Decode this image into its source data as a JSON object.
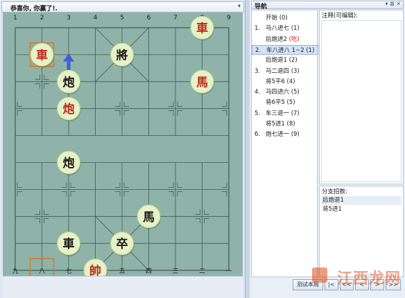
{
  "board_tab": {
    "title": "恭喜你, 你赢了!.",
    "arrow": "▾"
  },
  "board": {
    "top_files": [
      "1",
      "2",
      "3",
      "4",
      "5",
      "6",
      "7",
      "8",
      "9"
    ],
    "bottom_files": [
      "九",
      "八",
      "七",
      "六",
      "五",
      "四",
      "三",
      "二",
      "一"
    ],
    "pieces": [
      {
        "char": "車",
        "side": "red",
        "col": 7,
        "row": 0,
        "name": "red-chariot-piece"
      },
      {
        "char": "車",
        "side": "red",
        "col": 1,
        "row": 1,
        "name": "red-chariot-piece-2"
      },
      {
        "char": "將",
        "side": "black",
        "col": 4,
        "row": 1,
        "name": "black-general-piece"
      },
      {
        "char": "炮",
        "side": "black",
        "col": 2,
        "row": 2,
        "name": "black-cannon-piece"
      },
      {
        "char": "馬",
        "side": "red",
        "col": 7,
        "row": 2,
        "name": "red-horse-piece"
      },
      {
        "char": "炮",
        "side": "red",
        "col": 2,
        "row": 3,
        "name": "red-cannon-piece"
      },
      {
        "char": "炮",
        "side": "black",
        "col": 2,
        "row": 5,
        "name": "black-cannon-piece-2"
      },
      {
        "char": "馬",
        "side": "black",
        "col": 5,
        "row": 7,
        "name": "black-horse-piece"
      },
      {
        "char": "車",
        "side": "black",
        "col": 2,
        "row": 8,
        "name": "black-chariot-piece"
      },
      {
        "char": "卒",
        "side": "black",
        "col": 4,
        "row": 8,
        "name": "black-soldier-piece"
      },
      {
        "char": "帥",
        "side": "red",
        "col": 3,
        "row": 9,
        "name": "red-marshal-piece"
      }
    ],
    "highlight_from": {
      "col": 1,
      "row": 9
    },
    "highlight_to": {
      "col": 1,
      "row": 1
    },
    "arrow": {
      "from_col": 2,
      "from_row": 2,
      "to_col": 2,
      "to_row": 1
    },
    "colors": {
      "board": "#8fb3a8",
      "line": "#3c5a52",
      "red": "#c0281e",
      "black": "#1a1a1a",
      "piece_fill": "#e6f2c6",
      "highlight": "#d27a2c",
      "arrow": "#3f5fd8"
    }
  },
  "nav": {
    "title": "导航",
    "controls": "▾ ⊠ ✕",
    "moves": [
      {
        "num": "",
        "text": "开始 (0)",
        "tag": ""
      },
      {
        "num": "1.",
        "text": "马八进七 (1)",
        "tag": ""
      },
      {
        "num": "",
        "text": "后炮进2 ",
        "tag": "(吃)"
      },
      {
        "num": "2.",
        "text": "车八进八 1~2 (1)",
        "tag": ""
      },
      {
        "num": "",
        "text": "后炮退1 (2)",
        "tag": ""
      },
      {
        "num": "3.",
        "text": "马二退四 (3)",
        "tag": ""
      },
      {
        "num": "",
        "text": "将5平6 (4)",
        "tag": ""
      },
      {
        "num": "4.",
        "text": "马四进六 (5)",
        "tag": ""
      },
      {
        "num": "",
        "text": "将6平5 (5)",
        "tag": ""
      },
      {
        "num": "5.",
        "text": "车三退一 (7)",
        "tag": ""
      },
      {
        "num": "",
        "text": "将5进1 (8)",
        "tag": ""
      },
      {
        "num": "6.",
        "text": "炮七进一 (9)",
        "tag": ""
      }
    ],
    "selected_index": 3,
    "notes_label": "注释(可编辑):",
    "branch_label": "分支招数:",
    "branches": [
      "后炮退1",
      "将5进1"
    ],
    "buttons": [
      "测试本局",
      "|<",
      "<<",
      "<",
      ">",
      ">>"
    ],
    "watermark": "江西龙网"
  }
}
